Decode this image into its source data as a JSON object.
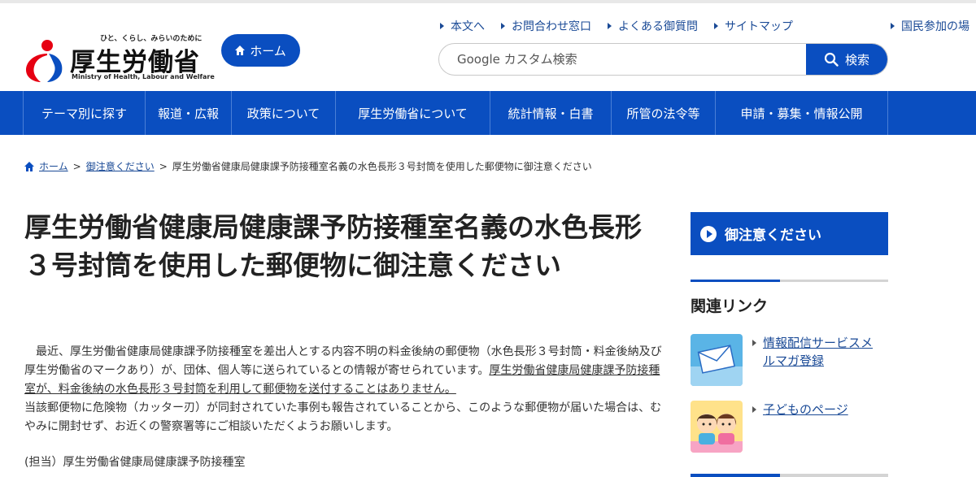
{
  "header": {
    "tagline": "ひと、くらし、みらいのために",
    "title": "厚生労働省",
    "title_en": "Ministry of Health, Labour and Welfare",
    "home_label": "ホーム",
    "util_links": [
      "本文へ",
      "お問合わせ窓口",
      "よくある御質問",
      "サイトマップ",
      "国民参加の場"
    ],
    "search_placeholder": "Google カスタム検索",
    "search_button": "検索"
  },
  "gnav": [
    "テーマ別に探す",
    "報道・広報",
    "政策について",
    "厚生労働省について",
    "統計情報・白書",
    "所管の法令等",
    "申請・募集・情報公開"
  ],
  "breadcrumb": {
    "home": "ホーム",
    "parent": "御注意ください",
    "current": "厚生労働省健康局健康課予防接種室名義の水色長形３号封筒を使用した郵便物に御注意ください"
  },
  "main": {
    "title": "厚生労働省健康局健康課予防接種室名義の水色長形３号封筒を使用した郵便物に御注意ください",
    "para1": "　最近、厚生労働省健康局健康課予防接種室を差出人とする内容不明の料金後納の郵便物（水色長形３号封筒・料金後納及び厚生労働省のマークあり）が、団体、個人等に送られているとの情報が寄せられています。",
    "para1_underlined": "厚生労働省健康局健康課予防接種室が、料金後納の水色長形３号封筒を利用して郵便物を送付することはありません。",
    "para2": "当該郵便物に危険物（カッター刃）が同封されていた事例も報告されていることから、このような郵便物が届いた場合は、むやみに開封せず、お近くの警察署等にご相談いただくようお願いします。",
    "contact": "(担当）厚生労働省健康局健康課予防接種室"
  },
  "sidebar": {
    "caution_label": "御注意ください",
    "related_heading": "関連リンク",
    "links": [
      "情報配信サービスメルマガ登録",
      "子どものページ"
    ]
  },
  "colors": {
    "brand_blue": "#0a4ec0",
    "link_blue": "#1a4a96"
  }
}
